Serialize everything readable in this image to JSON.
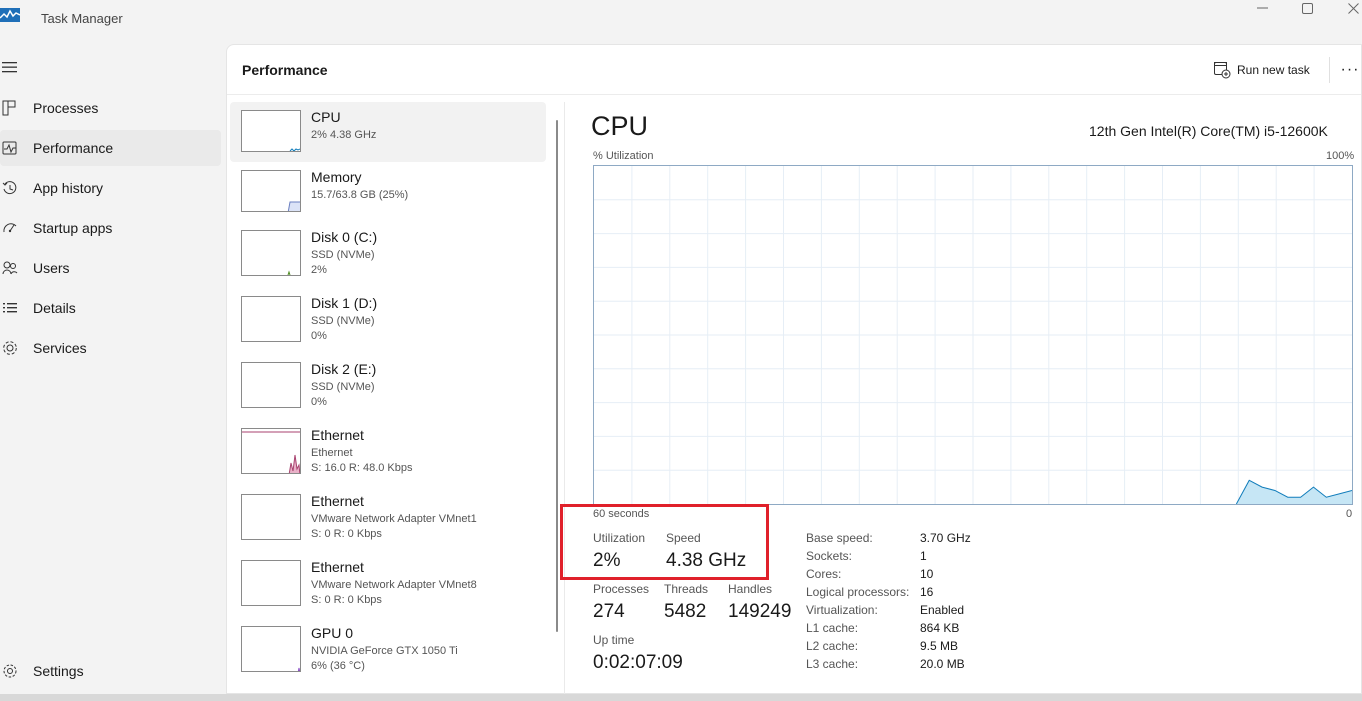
{
  "app": {
    "title": "Task Manager"
  },
  "nav": {
    "items": [
      {
        "label": "Processes",
        "icon": "processes-icon"
      },
      {
        "label": "Performance",
        "icon": "performance-icon",
        "active": true
      },
      {
        "label": "App history",
        "icon": "history-icon"
      },
      {
        "label": "Startup apps",
        "icon": "startup-icon"
      },
      {
        "label": "Users",
        "icon": "users-icon"
      },
      {
        "label": "Details",
        "icon": "details-icon"
      },
      {
        "label": "Services",
        "icon": "services-icon"
      }
    ],
    "settings": "Settings"
  },
  "header": {
    "title": "Performance",
    "run_new_task": "Run new task",
    "more": "···"
  },
  "resources": [
    {
      "name": "CPU",
      "sub1": "2% 4.38 GHz",
      "sub2": ""
    },
    {
      "name": "Memory",
      "sub1": "15.7/63.8 GB (25%)",
      "sub2": ""
    },
    {
      "name": "Disk 0 (C:)",
      "sub1": "SSD (NVMe)",
      "sub2": "2%"
    },
    {
      "name": "Disk 1 (D:)",
      "sub1": "SSD (NVMe)",
      "sub2": "0%"
    },
    {
      "name": "Disk 2 (E:)",
      "sub1": "SSD (NVMe)",
      "sub2": "0%"
    },
    {
      "name": "Ethernet",
      "sub1": "Ethernet",
      "sub2": "S: 16.0 R: 48.0 Kbps"
    },
    {
      "name": "Ethernet",
      "sub1": "VMware Network Adapter VMnet1",
      "sub2": "S: 0 R: 0 Kbps"
    },
    {
      "name": "Ethernet",
      "sub1": "VMware Network Adapter VMnet8",
      "sub2": "S: 0 R: 0 Kbps"
    },
    {
      "name": "GPU 0",
      "sub1": "NVIDIA GeForce GTX 1050 Ti",
      "sub2": "6% (36 °C)"
    }
  ],
  "detail": {
    "title": "CPU",
    "model": "12th Gen Intel(R) Core(TM) i5-12600K",
    "util_label": "% Utilization",
    "max_label": "100%",
    "seconds_label": "60 seconds",
    "zero_label": "0",
    "stats": {
      "utilization_label": "Utilization",
      "utilization": "2%",
      "speed_label": "Speed",
      "speed": "4.38 GHz",
      "processes_label": "Processes",
      "processes": "274",
      "threads_label": "Threads",
      "threads": "5482",
      "handles_label": "Handles",
      "handles": "149249",
      "uptime_label": "Up time",
      "uptime": "0:02:07:09"
    },
    "specs": [
      {
        "key": "Base speed:",
        "value": "3.70 GHz"
      },
      {
        "key": "Sockets:",
        "value": "1"
      },
      {
        "key": "Cores:",
        "value": "10"
      },
      {
        "key": "Logical processors:",
        "value": "16"
      },
      {
        "key": "Virtualization:",
        "value": "Enabled"
      },
      {
        "key": "L1 cache:",
        "value": "864 KB"
      },
      {
        "key": "L2 cache:",
        "value": "9.5 MB"
      },
      {
        "key": "L3 cache:",
        "value": "20.0 MB"
      }
    ],
    "graph_color": "#117dbb",
    "graph_fill": "#c6e6f5",
    "utilization_history": [
      0,
      0,
      0,
      0,
      0,
      0,
      0,
      0,
      0,
      0,
      0,
      0,
      0,
      0,
      0,
      0,
      0,
      0,
      0,
      0,
      0,
      0,
      0,
      0,
      0,
      0,
      0,
      0,
      0,
      0,
      0,
      0,
      0,
      0,
      0,
      0,
      0,
      0,
      0,
      0,
      0,
      0,
      0,
      0,
      0,
      0,
      0,
      0,
      0,
      0,
      0,
      7,
      5,
      4,
      2,
      2,
      5,
      2,
      3,
      4
    ]
  }
}
